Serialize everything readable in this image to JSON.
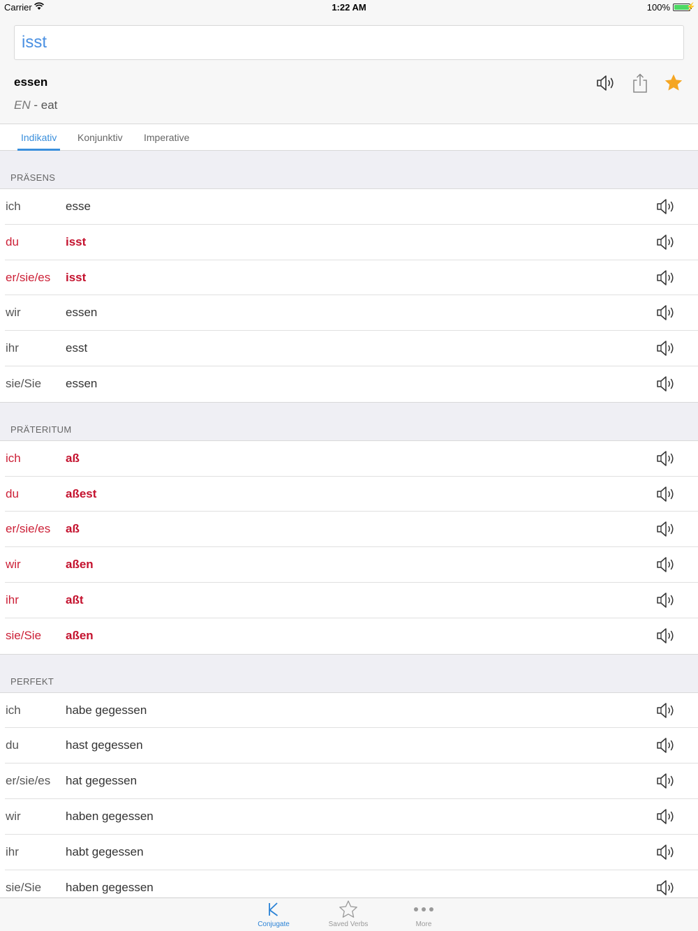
{
  "status_bar": {
    "carrier": "Carrier",
    "time": "1:22 AM",
    "battery": "100%"
  },
  "search": {
    "value": "isst"
  },
  "verb": {
    "infinitive": "essen",
    "lang": "EN",
    "separator": "-",
    "translation": "eat"
  },
  "tabs": [
    {
      "label": "Indikativ",
      "active": true
    },
    {
      "label": "Konjunktiv",
      "active": false
    },
    {
      "label": "Imperative",
      "active": false
    }
  ],
  "sections": [
    {
      "title": "PRÄSENS",
      "rows": [
        {
          "pronoun": "ich",
          "form": "esse",
          "irregular": false
        },
        {
          "pronoun": "du",
          "form": "isst",
          "irregular": true
        },
        {
          "pronoun": "er/sie/es",
          "form": "isst",
          "irregular": true
        },
        {
          "pronoun": "wir",
          "form": "essen",
          "irregular": false
        },
        {
          "pronoun": "ihr",
          "form": "esst",
          "irregular": false
        },
        {
          "pronoun": "sie/Sie",
          "form": "essen",
          "irregular": false
        }
      ]
    },
    {
      "title": "PRÄTERITUM",
      "rows": [
        {
          "pronoun": "ich",
          "form": "aß",
          "irregular": true
        },
        {
          "pronoun": "du",
          "form": "aßest",
          "irregular": true
        },
        {
          "pronoun": "er/sie/es",
          "form": "aß",
          "irregular": true
        },
        {
          "pronoun": "wir",
          "form": "aßen",
          "irregular": true
        },
        {
          "pronoun": "ihr",
          "form": "aßt",
          "irregular": true
        },
        {
          "pronoun": "sie/Sie",
          "form": "aßen",
          "irregular": true
        }
      ]
    },
    {
      "title": "PERFEKT",
      "rows": [
        {
          "pronoun": "ich",
          "form": "habe gegessen",
          "irregular": false
        },
        {
          "pronoun": "du",
          "form": "hast gegessen",
          "irregular": false
        },
        {
          "pronoun": "er/sie/es",
          "form": "hat gegessen",
          "irregular": false
        },
        {
          "pronoun": "wir",
          "form": "haben gegessen",
          "irregular": false
        },
        {
          "pronoun": "ihr",
          "form": "habt gegessen",
          "irregular": false
        },
        {
          "pronoun": "sie/Sie",
          "form": "haben gegessen",
          "irregular": false
        }
      ]
    }
  ],
  "tab_bar": {
    "items": [
      {
        "label": "Conjugate",
        "icon": "k-letter-icon",
        "active": true
      },
      {
        "label": "Saved Verbs",
        "icon": "star-outline-icon",
        "active": false
      },
      {
        "label": "More",
        "icon": "more-dots-icon",
        "active": false
      }
    ]
  },
  "colors": {
    "accent": "#3a8fdc",
    "irregular": "#c4122e",
    "favorite_star": "#f5a623"
  }
}
